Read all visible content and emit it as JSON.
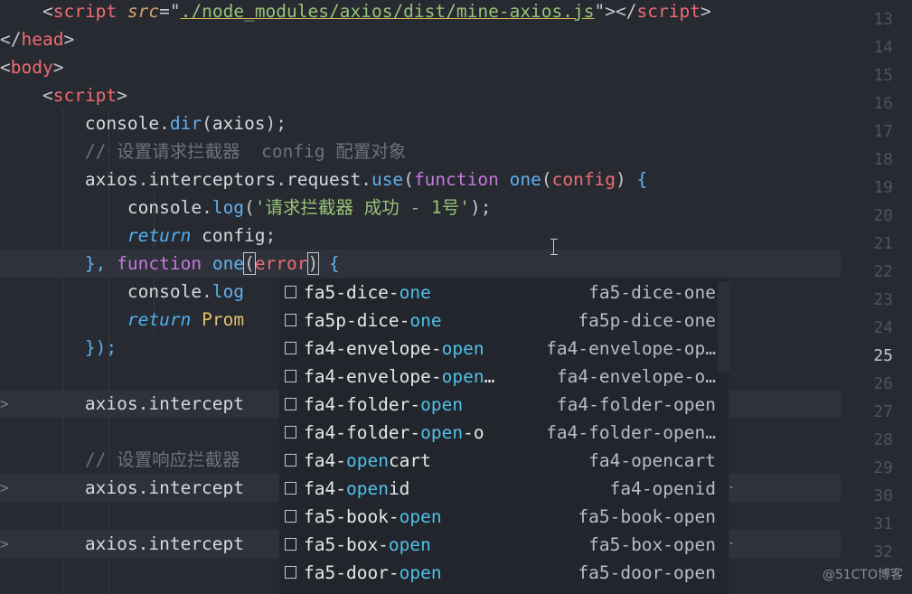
{
  "colors": {
    "background": "#272a30",
    "keyword": "#c678dd",
    "function": "#5fb0ef",
    "string": "#97c379",
    "tag": "#ef6b73",
    "match_highlight": "#4fc1e9"
  },
  "code": {
    "l13": {
      "indent": "    ",
      "lt": "<",
      "tag": "script",
      "attr": "src",
      "eq": "=\"",
      "src": "./node_modules/axios/dist/mine-axios.js",
      "q": "\"",
      "gt": ">",
      "close": "</",
      "tag2": "script",
      "gt2": ">"
    },
    "l14": {
      "lt": "</",
      "tag": "head",
      "gt": ">"
    },
    "l15": {
      "lt": "<",
      "tag": "body",
      "gt": ">"
    },
    "l16": {
      "indent": "    ",
      "lt": "<",
      "tag": "script",
      "gt": ">"
    },
    "l17": {
      "indent": "        ",
      "obj": "console",
      "dot": ".",
      "fn": "dir",
      "open": "(",
      "arg": "axios",
      "close": ");"
    },
    "l18": {
      "indent": "        ",
      "comment": "// 设置请求拦截器  config 配置对象"
    },
    "l19": {
      "indent": "        ",
      "obj": "axios",
      "dot1": ".",
      "prop": "interceptors",
      "dot2": ".",
      "prop2": "request",
      "dot3": ".",
      "fn": "use",
      "open": "(",
      "kw": "function",
      "sp": " ",
      "name": "one",
      "p_open": "(",
      "param": "config",
      "p_close": ")",
      "brace": " {"
    },
    "l20": {
      "indent": "            ",
      "obj": "console",
      "dot": ".",
      "fn": "log",
      "open": "(",
      "str": "'请求拦截器 成功 - 1号'",
      "close": ");"
    },
    "l21": {
      "indent": "            ",
      "kw": "return",
      "sp": " ",
      "val": "config",
      "semi": ";"
    },
    "l22": {
      "indent": "        ",
      "close": "}, ",
      "kw": "function",
      "sp": " ",
      "name": "one",
      "p_open": "(",
      "param": "error",
      "p_close": ")",
      "brace": " {"
    },
    "l23": {
      "indent": "            ",
      "obj": "console",
      "dot": ".",
      "fn": "log"
    },
    "l24": {
      "indent": "            ",
      "kw": "return",
      "sp": " ",
      "val": "Prom"
    },
    "l25": {
      "indent": "        ",
      "close": "});"
    },
    "l27": {
      "indent": "        ",
      "text": "axios.intercept"
    },
    "l29": {
      "indent": "        ",
      "comment": "// 设置响应拦截器"
    },
    "l30": {
      "indent": "        ",
      "text": "axios.intercept"
    },
    "l32": {
      "indent": "        ",
      "text": "axios.intercept"
    }
  },
  "line_numbers": [
    "13",
    "14",
    "15",
    "16",
    "17",
    "18",
    "19",
    "20",
    "21",
    "22",
    "23",
    "24",
    "25",
    "26",
    "27",
    "28",
    "29",
    "30",
    "31",
    "32"
  ],
  "active_line": "25",
  "fold_marker": ">",
  "suggestions": [
    {
      "pre": "fa5-dice-",
      "match": "one",
      "post": "",
      "detail": "fa5-dice-one",
      "dot": ""
    },
    {
      "pre": "fa5p-dice-",
      "match": "one",
      "post": "",
      "detail": "fa5p-dice-one",
      "dot": ""
    },
    {
      "pre": "fa4-envelope-",
      "match": "open",
      "post": "",
      "detail": "fa4-envelope-op…",
      "dot": ""
    },
    {
      "pre": "fa4-envelope-",
      "match": "open",
      "post": "…",
      "detail": "fa4-envelope-o…",
      "dot": ""
    },
    {
      "pre": "fa4-folder-",
      "match": "open",
      "post": "",
      "detail": "fa4-folder-open",
      "dot": ""
    },
    {
      "pre": "fa4-folder-",
      "match": "open",
      "post": "-o",
      "detail": "fa4-folder-open…",
      "dot": ""
    },
    {
      "pre": "fa4-",
      "match": "open",
      "post": "cart",
      "detail": "fa4-opencart",
      "dot": ""
    },
    {
      "pre": "fa4-",
      "match": "open",
      "post": "id",
      "detail": "fa4-openid",
      "dot": "·"
    },
    {
      "pre": "fa5-book-",
      "match": "open",
      "post": "",
      "detail": "fa5-book-open",
      "dot": ""
    },
    {
      "pre": "fa5-box-",
      "match": "open",
      "post": "",
      "detail": "fa5-box-open",
      "dot": "·"
    },
    {
      "pre": "fa5-door-",
      "match": "open",
      "post": "",
      "detail": "fa5-door-open",
      "dot": ""
    }
  ],
  "watermark": "@51CTO博客"
}
